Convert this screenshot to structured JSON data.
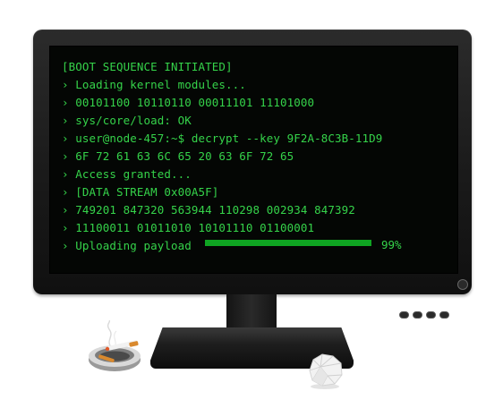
{
  "terminal": {
    "lines": [
      "[BOOT SEQUENCE INITIATED]",
      "› Loading kernel modules...",
      "› 00101100 10110110 00011101 11101000",
      "› sys/core/load: OK",
      "› user@node-457:~$ decrypt --key 9F2A-8C3B-11D9",
      "› 6F 72 61 63 6C 65 20 63 6F 72 65",
      "› Access granted...",
      "› [DATA STREAM 0x00A5F]",
      "› 749201 847320 563944 110298 002934 847392",
      "› 11100011 01011010 10101110 01100001",
      "› Uploading payload"
    ],
    "upload_progress_percent": 99,
    "upload_progress_label": "99%"
  },
  "colors": {
    "terminal_text": "#35d34a",
    "progress_fill": "#0fa422",
    "screen": "#040604",
    "bezel": "#1e1e1e"
  },
  "icons": {
    "ashtray": "ashtray-with-cigarette",
    "paper": "crumpled-paper-ball",
    "power": "power-button"
  }
}
